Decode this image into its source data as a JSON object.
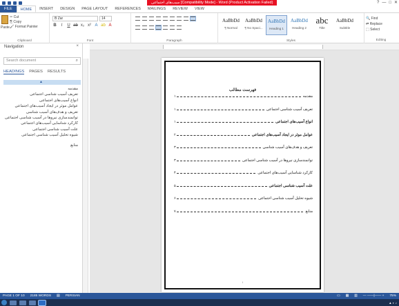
{
  "window": {
    "title": "سیب‌های اجتماعی [Compatibility Mode] - Word (Product Activation Failed)",
    "controls": [
      "?",
      "—",
      "□",
      "✕"
    ]
  },
  "tabs": [
    "FILE",
    "HOME",
    "INSERT",
    "DESIGN",
    "PAGE LAYOUT",
    "REFERENCES",
    "MAILINGS",
    "REVIEW",
    "VIEW"
  ],
  "ribbon": {
    "clipboard": {
      "paste": "Paste",
      "cut": "Cut",
      "copy": "Copy",
      "format_painter": "Format Painter",
      "label": "Clipboard"
    },
    "font": {
      "name": "B Zar",
      "size": "14",
      "label": "Font"
    },
    "paragraph": {
      "label": "Paragraph"
    },
    "styles": {
      "label": "Styles",
      "items": [
        {
          "preview": "AaBbDd",
          "name": "¶ Normal"
        },
        {
          "preview": "AaBbDd",
          "name": "¶ No Spaci..."
        },
        {
          "preview": "AaBbDd",
          "name": "Heading 1"
        },
        {
          "preview": "AaBbDd",
          "name": "Heading 2"
        },
        {
          "preview": "abc",
          "name": "Title"
        },
        {
          "preview": "AaBbDd",
          "name": "Subtitle"
        }
      ]
    },
    "editing": {
      "label": "Editing",
      "find": "Find",
      "replace": "Replace",
      "select": "Select"
    }
  },
  "nav": {
    "title": "Navigation",
    "close": "×",
    "search_placeholder": "Search document",
    "tabs": [
      "HEADINGS",
      "PAGES",
      "RESULTS"
    ],
    "items": [
      "مقدمه",
      "تعریف آسیب شناسی اجتماعی",
      "انواع آسیب‌های اجتماعی",
      "عوامل موثر در ایجاد آسیب‌های اجتماعی",
      "تعریف و هدف‌های آسیب شناسی",
      "توانمندسازی نیرو‌ها در آسیب شناسی اجتماعی",
      "کارکرد شناسایی آسیب‌های اجتماعی",
      "علت آسیب شناسی اجتماعی",
      "شیوه تحلیل آسیب شناسی اجتماعی",
      "منابع"
    ]
  },
  "document": {
    "toc_title": "فهرست مطالب",
    "toc": [
      {
        "text": "مقدمه",
        "page": "۱",
        "bold": false
      },
      {
        "text": "تعریف آسیب شناسی اجتماعی",
        "page": "۱",
        "bold": false
      },
      {
        "text": "انواع آسیب‌های اجتماعی",
        "page": "۱",
        "bold": true
      },
      {
        "text": "عوامل موثر در ایجاد آسیب‌های اجتماعی",
        "page": "۲",
        "bold": true
      },
      {
        "text": "تعریف و هدف‌های آسیب شناسی",
        "page": "۳",
        "bold": false
      },
      {
        "text": "توانمندسازی نیرو‌ها در آسیب شناسی اجتماعی",
        "page": "۳",
        "bold": false
      },
      {
        "text": "کارکرد شناسایی آسیب‌های اجتماعی",
        "page": "۴",
        "bold": false
      },
      {
        "text": "علت آسیب شناسی اجتماعی",
        "page": "۵",
        "bold": true
      },
      {
        "text": "شیوه تحلیل آسیب شناسی اجتماعی",
        "page": "۶",
        "bold": false
      },
      {
        "text": "منابع",
        "page": "۷",
        "bold": false
      }
    ],
    "page_number": "۱"
  },
  "status": {
    "page": "PAGE 1 OF 10",
    "words": "2185 WORDS",
    "language": "PERSIAN",
    "zoom": "75%"
  },
  "colors": {
    "accent": "#2b579a",
    "title_alert": "#e81123"
  }
}
